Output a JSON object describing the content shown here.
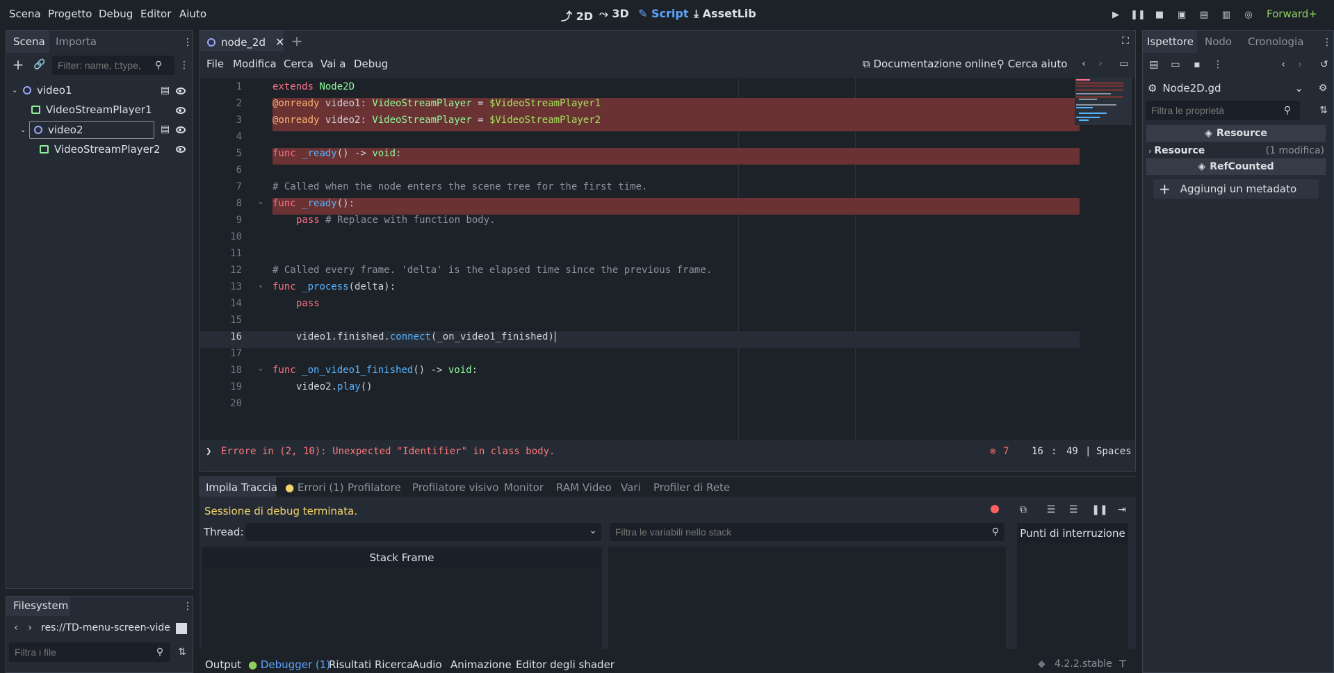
{
  "menu": [
    "Scena",
    "Progetto",
    "Debug",
    "Editor",
    "Aiuto"
  ],
  "workspaces": [
    {
      "icon": "2d-icon",
      "label": "2D"
    },
    {
      "icon": "3d-icon",
      "label": "3D"
    },
    {
      "icon": "script-icon",
      "label": "Script"
    },
    {
      "icon": "assetlib-icon",
      "label": "AssetLib"
    }
  ],
  "renderer": "Forward+",
  "scene_panel": {
    "tabs": [
      "Scena",
      "Importa"
    ],
    "filter_placeholder": "Filter: name, t:type,",
    "nodes": [
      "video1",
      "VideoStreamPlayer1",
      "video2",
      "VideoStreamPlayer2"
    ]
  },
  "filesystem": {
    "tab": "Filesystem",
    "path": "res://TD-menu-screen-vide",
    "filter_placeholder": "Filtra i file"
  },
  "editor": {
    "file_tab": "node_2d",
    "menu": [
      "File",
      "Modifica",
      "Cerca",
      "Vai a",
      "Debug"
    ],
    "docs_link": "Documentazione online",
    "help_search": "Cerca aiuto",
    "lines": [
      "1",
      "2",
      "3",
      "4",
      "5",
      "6",
      "7",
      "8",
      "9",
      "10",
      "11",
      "12",
      "13",
      "14",
      "15",
      "16",
      "17",
      "18",
      "19",
      "20"
    ],
    "error_message": "Errore in (2, 10): Unexpected \"Identifier\" in class body.",
    "error_count": "7",
    "cursor_line": "16",
    "cursor_col": "49",
    "indent_mode": "Spaces"
  },
  "debugger": {
    "tabs": [
      "Impila Traccia",
      "Errori (1)",
      "Profilatore",
      "Profilatore visivo",
      "Monitor",
      "RAM Video",
      "Vari",
      "Profiler di Rete"
    ],
    "status": "Sessione di debug terminata.",
    "thread_label": "Thread:",
    "stack_frame_header": "Stack Frame",
    "filter_vars_placeholder": "Filtra le variabili nello stack",
    "breakpoints_label": "Punti di interruzione"
  },
  "bottom_tabs": [
    "Output",
    "Debugger (1)",
    "Risultati Ricerca",
    "Audio",
    "Animazione",
    "Editor degli shader"
  ],
  "version": "4.2.2.stable",
  "inspector": {
    "tabs": [
      "Ispettore",
      "Nodo",
      "Cronologia"
    ],
    "resource_name": "Node2D.gd",
    "filter_placeholder": "Filtra le proprietà",
    "section_resource": "Resource",
    "prop_resource": "Resource",
    "prop_resource_value": "(1 modifica)",
    "section_refcounted": "RefCounted",
    "add_metadata": "Aggiungi un metadato"
  },
  "colors": {
    "accent": "#5fa4ff",
    "error_line": "#6b3234",
    "error_text": "#ff7a7a",
    "status_text": "#f1d36b"
  }
}
